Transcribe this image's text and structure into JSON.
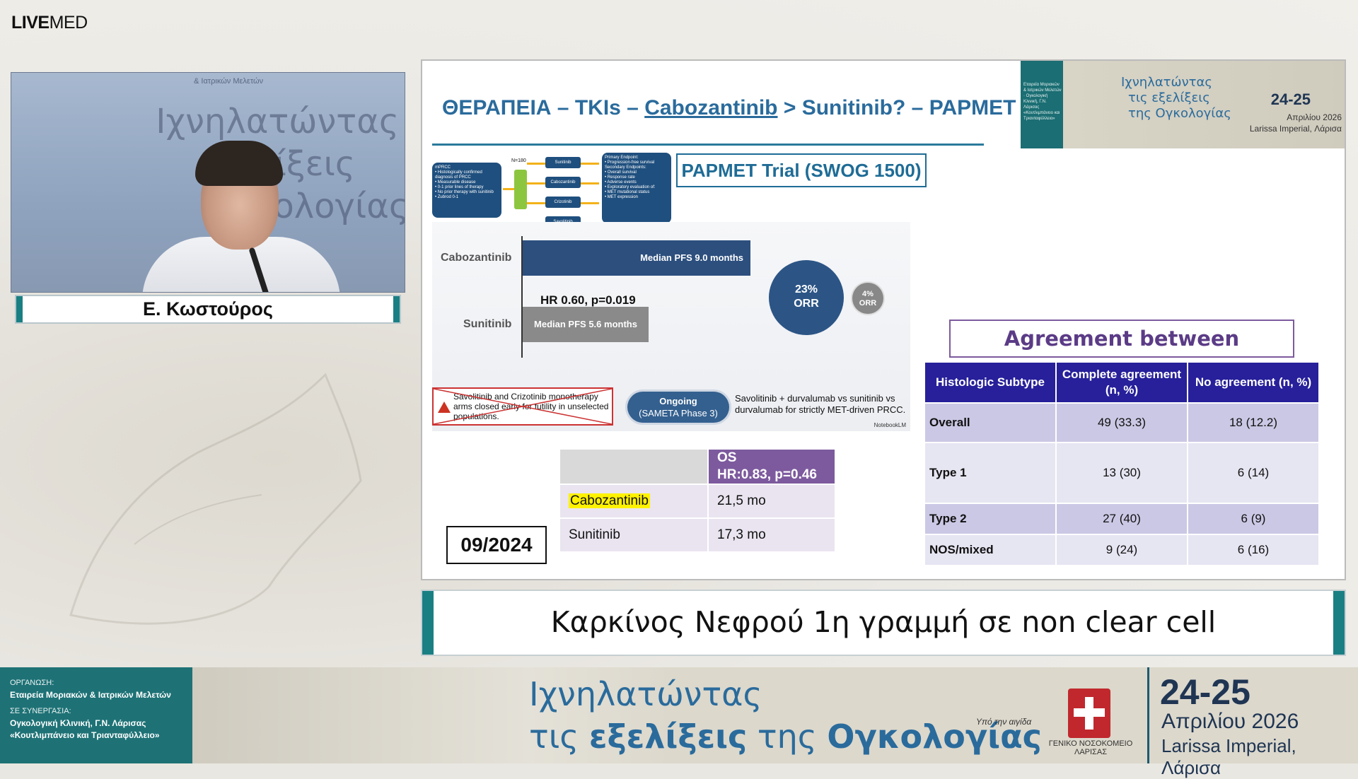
{
  "brand": {
    "bold": "LIVE",
    "light": "MED"
  },
  "speaker": {
    "name": "Ε. Κωστούρος",
    "bg_text_1": "Ιχνηλατώντας",
    "bg_text_2": "εξελίξεις",
    "bg_text_3": "Ογκολογίας",
    "bg_small": "& Ιατρικών Μελετών"
  },
  "slide": {
    "title_prefix": "ΘΕΡΑΠΕΙΑ – TKIs – ",
    "title_underlined": "Cabozantinib",
    "title_suffix": " > Sunitinib? – PAPMET",
    "banner": {
      "title_lines": [
        "Ιχνηλατώντας",
        "τις εξελίξεις",
        "της Ογκολογίας"
      ],
      "dates": "24-25",
      "month": "Απριλίου 2026",
      "place": "Larissa Imperial, Λάρισα",
      "org_text": "Εταιρεία Μοριακών & Ιατρικών Μελετών · Ογκολογική Κλινική, Γ.Ν. Λάρισας «Κουτλιμπάνειο και Τριανταφύλλειο»"
    },
    "trial_label": "PAPMET Trial (SWOG 1500)",
    "schema": {
      "left_box": [
        "mPRCC",
        "• Histologically confirmed diagnosis of PRCC",
        "• Measurable disease",
        "• 0-1 prior lines of therapy",
        "• No prior therapy with sunitinib",
        "• Zubrod 0-1"
      ],
      "n": "N=180",
      "arms": [
        "Sunitinib",
        "Cabozantinib",
        "Crizotinib",
        "Savolitinib"
      ],
      "right_box": [
        "Primary Endpoint:",
        "• Progression-free survival",
        "Secondary Endpoints:",
        "• Overall survival",
        "• Response rate",
        "• Adverse events",
        "• Exploratory evaluation of:",
        "  • MET mutational status",
        "  • MET expression"
      ]
    },
    "pfs": {
      "cabo_label": "Cabozantinib",
      "cabo_bar": "Median PFS 9.0 months",
      "hr": "HR 0.60, p=0.019",
      "suni_label": "Sunitinib",
      "suni_bar": "Median PFS 5.6 months",
      "orr_big_pct": "23%",
      "orr_big_lbl": "ORR",
      "orr_small_pct": "4%",
      "orr_small_lbl": "ORR",
      "closed_note": "Savolitinib and Crizotinib monotherapy arms closed early for futility in unselected populations.",
      "ongoing_1": "Ongoing",
      "ongoing_2": "(SAMETA Phase 3)",
      "ongoing_desc": "Savolitinib + durvalumab vs sunitinib vs durvalumab for strictly MET-driven PRCC.",
      "source": "NotebookLM"
    },
    "os_table": {
      "header_1": "OS",
      "header_2": "HR:0.83, p=0.46",
      "rows": [
        {
          "drug": "Cabozantinib",
          "value": "21,5 mo"
        },
        {
          "drug": "Sunitinib",
          "value": "17,3 mo"
        }
      ]
    },
    "date_box": "09/2024",
    "agreement": {
      "title": "Agreement between pathologists",
      "headers": [
        "Histologic Subtype",
        "Complete agreement (n, %)",
        "No agreement (n, %)"
      ],
      "rows": [
        {
          "subtype": "Overall",
          "complete": "49 (33.3)",
          "none": "18 (12.2)"
        },
        {
          "subtype": "Type 1",
          "complete": "13 (30)",
          "none": "6 (14)"
        },
        {
          "subtype": "Type 2",
          "complete": "27 (40)",
          "none": "6 (9)"
        },
        {
          "subtype": "NOS/mixed",
          "complete": "9 (24)",
          "none": "6 (16)"
        }
      ]
    }
  },
  "caption": "Καρκίνος Νεφρού 1η γραμμή σε non clear cell",
  "footer": {
    "org_label": "ΟΡΓΑΝΩΣΗ:",
    "org_value": "Εταιρεία Μοριακών & Ιατρικών Μελετών",
    "collab_label": "ΣΕ ΣΥΝΕΡΓΑΣΙΑ:",
    "collab_value_1": "Ογκολογική Κλινική, Γ.Ν. Λάρισας",
    "collab_value_2": "«Κουτλιμπάνειο και Τριανταφύλλειο»",
    "title_line_1": "Ιχνηλατώντας",
    "title_line_2_pre": "τις ",
    "title_line_2_b1": "εξελίξεις",
    "title_line_2_mid": " της ",
    "title_line_2_b2": "Ογκολογίας",
    "aegis": "Υπό την αιγίδα",
    "hospital": "ΓΕΝΙΚΟ ΝΟΣΟΚΟΜΕΙΟ ΛΑΡΙΣΑΣ",
    "dates": "24-25",
    "month": "Απριλίου 2026",
    "place": "Larissa Imperial, Λάρισα"
  },
  "colors": {
    "teal": "#1a7f83",
    "slide_blue": "#2a6b9c",
    "purple": "#7d5a9e",
    "navy_table": "#27209a"
  }
}
